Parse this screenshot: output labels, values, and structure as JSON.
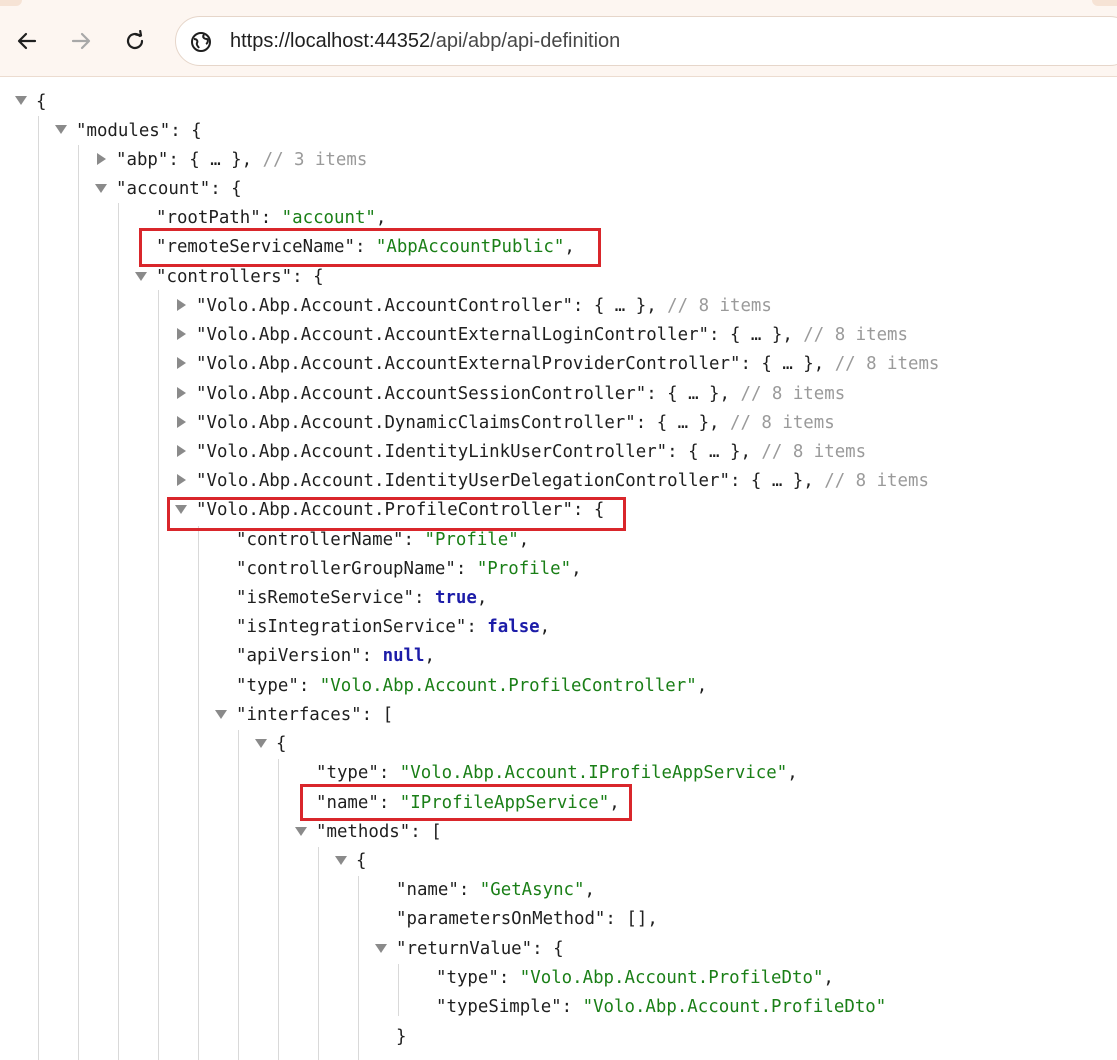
{
  "browser": {
    "url_host": "https://localhost:44352",
    "url_path": "/api/abp/api-definition",
    "icons": [
      "back-arrow-icon",
      "forward-arrow-icon",
      "reload-icon",
      "site-info-icon"
    ]
  },
  "json": {
    "l01": "{",
    "l02_key": "\"modules\"",
    "l02_rest": ": {",
    "l03_key": "\"abp\"",
    "l03_rest": ": { … },",
    "l03_comment": "// 3 items",
    "l04_key": "\"account\"",
    "l04_rest": ": {",
    "l05_key": "\"rootPath\"",
    "l05_val": "\"account\"",
    "l06_key": "\"remoteServiceName\"",
    "l06_val": "\"AbpAccountPublic\"",
    "l07_key": "\"controllers\"",
    "l07_rest": ": {",
    "controllers_collapsed": [
      {
        "key": "\"Volo.Abp.Account.AccountController\"",
        "comment": "// 8 items"
      },
      {
        "key": "\"Volo.Abp.Account.AccountExternalLoginController\"",
        "comment": "// 8 items"
      },
      {
        "key": "\"Volo.Abp.Account.AccountExternalProviderController\"",
        "comment": "// 8 items"
      },
      {
        "key": "\"Volo.Abp.Account.AccountSessionController\"",
        "comment": "// 8 items"
      },
      {
        "key": "\"Volo.Abp.Account.DynamicClaimsController\"",
        "comment": "// 8 items"
      },
      {
        "key": "\"Volo.Abp.Account.IdentityLinkUserController\"",
        "comment": "// 8 items"
      },
      {
        "key": "\"Volo.Abp.Account.IdentityUserDelegationController\"",
        "comment": "// 8 items"
      }
    ],
    "collapsed_body": ": { … },",
    "l15_key": "\"Volo.Abp.Account.ProfileController\"",
    "l15_rest": ": {",
    "l16_key": "\"controllerName\"",
    "l16_val": "\"Profile\"",
    "l17_key": "\"controllerGroupName\"",
    "l17_val": "\"Profile\"",
    "l18_key": "\"isRemoteService\"",
    "l18_val": "true",
    "l19_key": "\"isIntegrationService\"",
    "l19_val": "false",
    "l20_key": "\"apiVersion\"",
    "l20_val": "null",
    "l21_key": "\"type\"",
    "l21_val": "\"Volo.Abp.Account.ProfileController\"",
    "l22_key": "\"interfaces\"",
    "l22_rest": ": [",
    "l23": "{",
    "l24_key": "\"type\"",
    "l24_val": "\"Volo.Abp.Account.IProfileAppService\"",
    "l25_key": "\"name\"",
    "l25_val": "\"IProfileAppService\"",
    "l26_key": "\"methods\"",
    "l26_rest": ": [",
    "l27": "{",
    "l28_key": "\"name\"",
    "l28_val": "\"GetAsync\"",
    "l29_key": "\"parametersOnMethod\"",
    "l29_val": "[]",
    "l30_key": "\"returnValue\"",
    "l30_rest": ": {",
    "l31_key": "\"type\"",
    "l31_val": "\"Volo.Abp.Account.ProfileDto\"",
    "l32_key": "\"typeSimple\"",
    "l32_val": "\"Volo.Abp.Account.ProfileDto\"",
    "l33": "}",
    "colon": ": ",
    "comma": ","
  },
  "colors": {
    "string": "#1a7f17",
    "keyword": "#1c1ca8",
    "comment": "#9a9a9a",
    "highlight": "#d9262b"
  }
}
